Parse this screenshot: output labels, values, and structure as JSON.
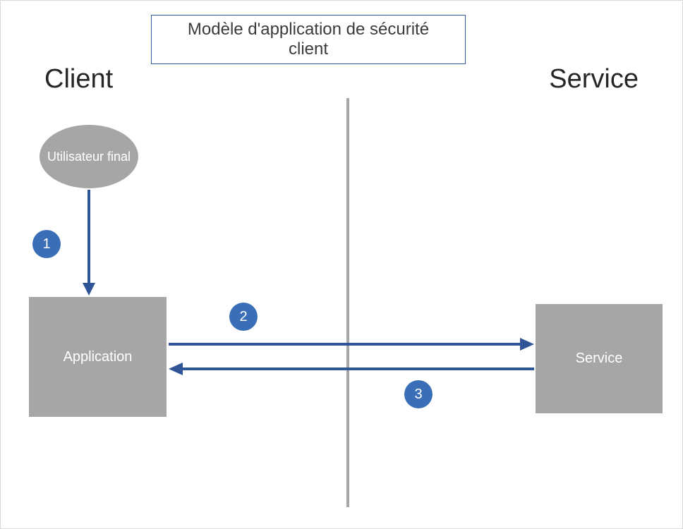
{
  "title": "Modèle d'application de sécurité client",
  "sections": {
    "left": "Client",
    "right": "Service"
  },
  "nodes": {
    "end_user": "Utilisateur final",
    "application": "Application",
    "service": "Service"
  },
  "steps": {
    "s1": "1",
    "s2": "2",
    "s3": "3"
  },
  "colors": {
    "accent": "#3a6fb7",
    "arrow": "#2f5597",
    "node_fill": "#a6a6a6",
    "border": "#2e5c9a"
  }
}
